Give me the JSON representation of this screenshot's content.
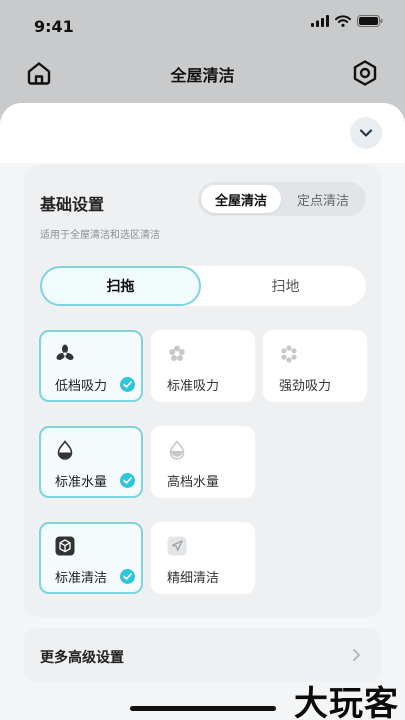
{
  "status_bar": {
    "time": "9:41"
  },
  "header": {
    "title": "全屋清洁"
  },
  "card": {
    "title": "基础设置",
    "subtitle": "适用于全屋清洁和选区清洁",
    "mode_tabs": [
      {
        "label": "全屋清洁",
        "active": true
      },
      {
        "label": "定点清洁",
        "active": false
      }
    ],
    "type_tabs": [
      {
        "label": "扫拖",
        "active": true
      },
      {
        "label": "扫地",
        "active": false
      }
    ],
    "suction": [
      {
        "label": "低档吸力",
        "icon": "fan-icon",
        "selected": true
      },
      {
        "label": "标准吸力",
        "icon": "fan-icon",
        "selected": false
      },
      {
        "label": "强劲吸力",
        "icon": "fan-icon",
        "selected": false
      }
    ],
    "water": [
      {
        "label": "标准水量",
        "icon": "water-drop-icon",
        "selected": true
      },
      {
        "label": "高档水量",
        "icon": "water-drop-icon",
        "selected": false
      }
    ],
    "route": [
      {
        "label": "标准清洁",
        "icon": "cube-icon",
        "selected": true
      },
      {
        "label": "精细清洁",
        "icon": "navigation-icon",
        "selected": false
      }
    ]
  },
  "more": {
    "label": "更多高级设置"
  },
  "watermark": "大玩客",
  "colors": {
    "accent": "#2ec6d8",
    "border": "#7dd3df"
  }
}
